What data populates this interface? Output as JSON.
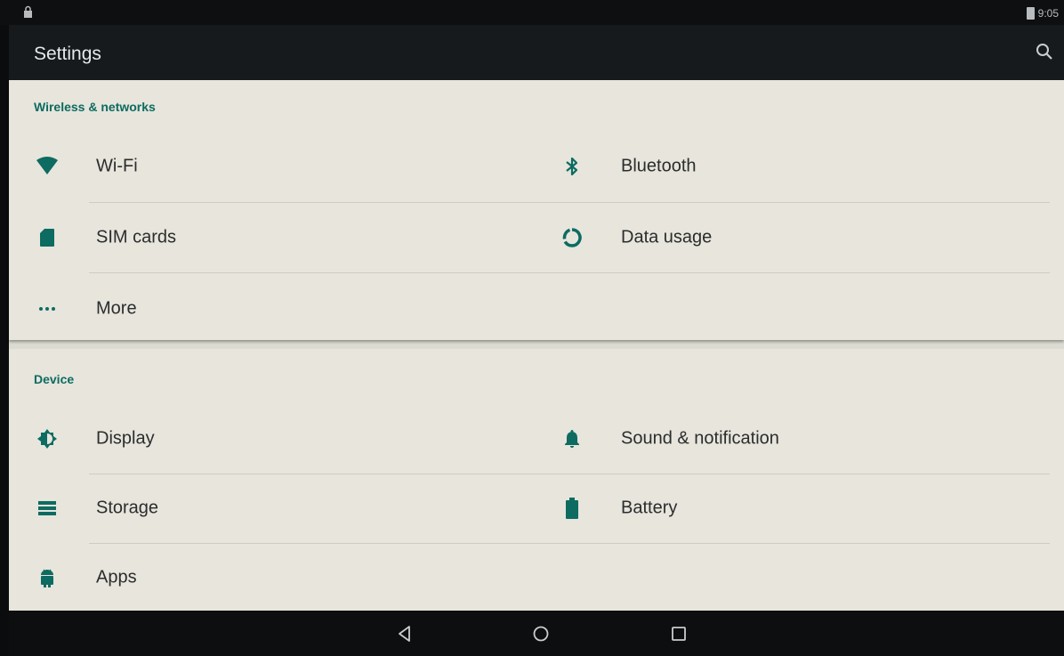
{
  "status_bar": {
    "time": "9:05"
  },
  "app_bar": {
    "title": "Settings"
  },
  "sections": {
    "wireless": {
      "title": "Wireless & networks",
      "items": {
        "wifi": "Wi-Fi",
        "bluetooth": "Bluetooth",
        "sim": "SIM cards",
        "data": "Data usage",
        "more": "More"
      }
    },
    "device": {
      "title": "Device",
      "items": {
        "display": "Display",
        "sound": "Sound & notification",
        "storage": "Storage",
        "battery": "Battery",
        "apps": "Apps"
      }
    }
  },
  "icons": {
    "status_lock": "lock-icon",
    "search": "search-icon",
    "wifi": "wifi-icon",
    "bluetooth": "bluetooth-icon",
    "sim": "sim-card-icon",
    "data": "data-usage-icon",
    "more": "more-dots-icon",
    "display": "brightness-icon",
    "sound": "bell-icon",
    "storage": "storage-icon",
    "battery": "battery-icon",
    "apps": "android-icon",
    "nav_back": "back-icon",
    "nav_home": "home-icon",
    "nav_recents": "recents-icon"
  },
  "colors": {
    "accent": "#0d6b61",
    "app_bar": "#161a1c",
    "background": "#e7e5dc"
  }
}
